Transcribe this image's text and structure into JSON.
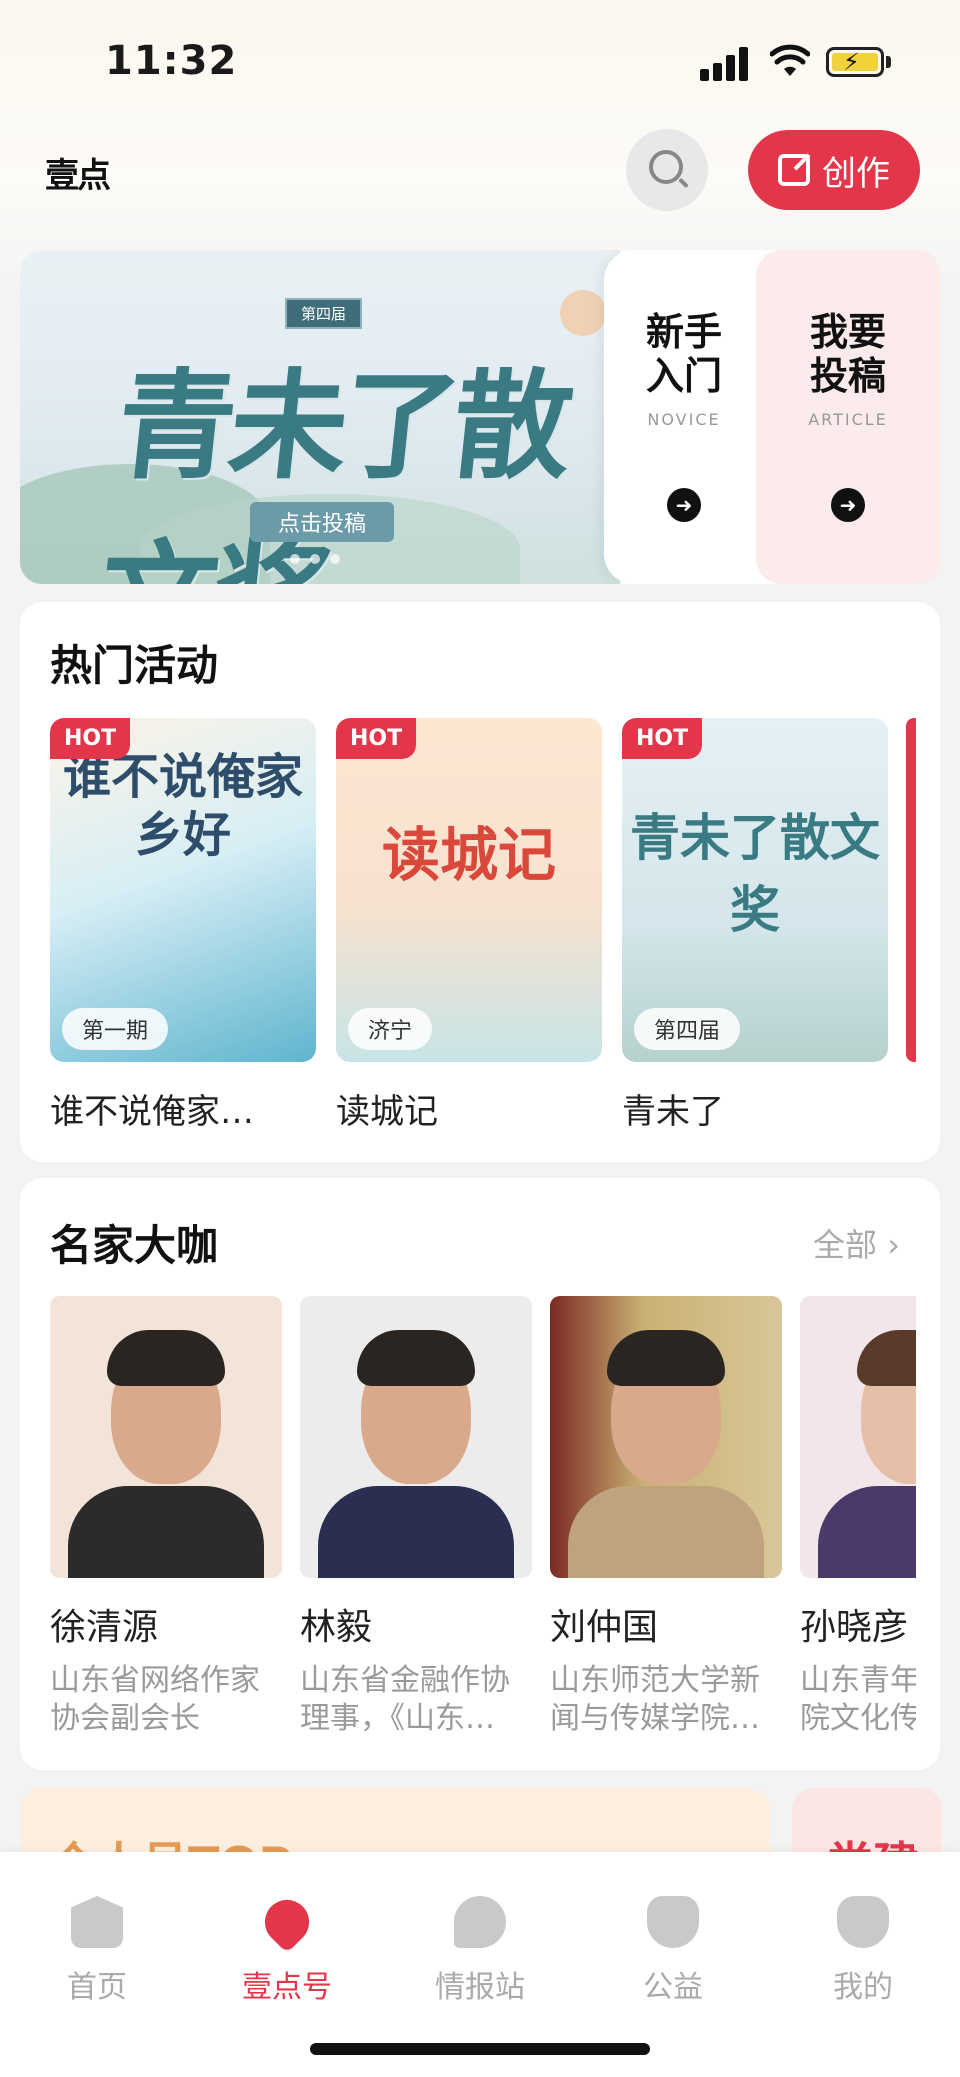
{
  "status": {
    "time": "11:32"
  },
  "header": {
    "logo_text": "壹点",
    "create_label": "创作"
  },
  "banner": {
    "edition": "第四届",
    "title": "青未了散文奖",
    "cta": "点击投稿",
    "panels": [
      {
        "title_line1": "新手",
        "title_line2": "入门",
        "sub": "NOVICE"
      },
      {
        "title_line1": "我要",
        "title_line2": "投稿",
        "sub": "ARTICLE"
      }
    ]
  },
  "activities": {
    "title": "热门活动",
    "hot_label": "HOT",
    "items": [
      {
        "tag": "第一期",
        "name": "谁不说俺家…",
        "art": "谁不说俺家乡好"
      },
      {
        "tag": "济宁",
        "name": "读城记",
        "art": "读城记"
      },
      {
        "tag": "第四届",
        "name": "青未了",
        "art": "青未了散文奖"
      }
    ]
  },
  "masters": {
    "title": "名家大咖",
    "all_label": "全部",
    "people": [
      {
        "name": "徐清源",
        "desc": "山东省网络作家协会副会长"
      },
      {
        "name": "林毅",
        "desc": "山东省金融作协理事，《山东…"
      },
      {
        "name": "刘仲国",
        "desc": "山东师范大学新闻与传媒学院…"
      },
      {
        "name": "孙晓彦",
        "desc": "山东青年政治学院文化传"
      }
    ]
  },
  "peeks": {
    "left": "个人号TOP",
    "right": "党建"
  },
  "tabs": [
    {
      "label": "首页",
      "icon": "home-icon"
    },
    {
      "label": "壹点号",
      "icon": "heart-icon"
    },
    {
      "label": "情报站",
      "icon": "chat-icon"
    },
    {
      "label": "公益",
      "icon": "charity-icon"
    },
    {
      "label": "我的",
      "icon": "profile-icon"
    }
  ],
  "colors": {
    "accent": "#e3364a",
    "tab_inactive": "#aaaaaa"
  }
}
